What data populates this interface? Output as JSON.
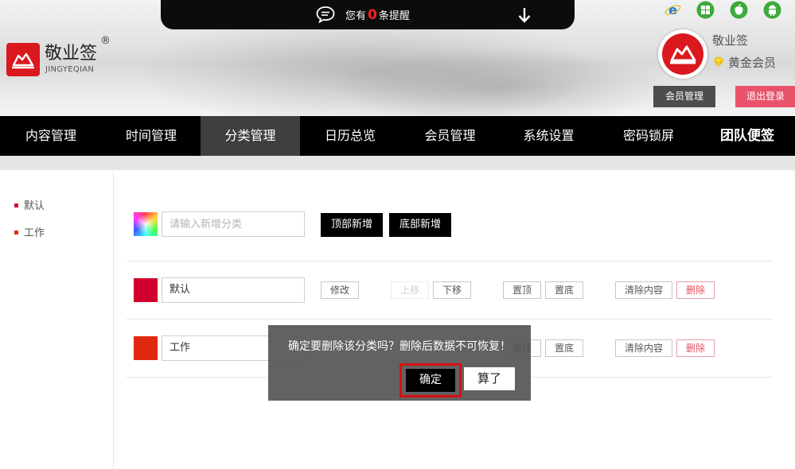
{
  "notification": {
    "prefix": "您有",
    "count": "0",
    "suffix": "条提醒"
  },
  "brand": {
    "name": "敬业签",
    "registered": "®",
    "pinyin": "JINGYEQIAN",
    "color": "#d9191e"
  },
  "browser_icons": [
    "ie-icon",
    "windows-icon",
    "apple-icon",
    "android-icon"
  ],
  "user": {
    "name": "敬业签",
    "level": "黄金会员"
  },
  "header_buttons": {
    "member": "会员管理",
    "logout": "退出登录"
  },
  "nav": {
    "items": [
      "内容管理",
      "时间管理",
      "分类管理",
      "日历总览",
      "会员管理",
      "系统设置",
      "密码锁屏",
      "团队便签"
    ],
    "active": "分类管理"
  },
  "sidebar": {
    "items": [
      {
        "label": "默认",
        "color": "#d2002e"
      },
      {
        "label": "工作",
        "color": "#e02a10"
      }
    ]
  },
  "add_row": {
    "placeholder": "请输入新增分类",
    "add_top": "顶部新增",
    "add_bottom": "底部新增"
  },
  "categories": [
    {
      "name": "默认",
      "color": "#d2002e",
      "edit": "修改",
      "up": "上移",
      "down": "下移",
      "top": "置顶",
      "bottom": "置底",
      "clear": "清除内容",
      "delete": "删除"
    },
    {
      "name": "工作",
      "color": "#e02a10",
      "top": "置顶",
      "bottom": "置底",
      "clear": "清除内容",
      "delete": "删除"
    }
  ],
  "dialog": {
    "message": "确定要删除该分类吗？删除后数据不可恢复！",
    "confirm": "确定",
    "cancel": "算了"
  }
}
